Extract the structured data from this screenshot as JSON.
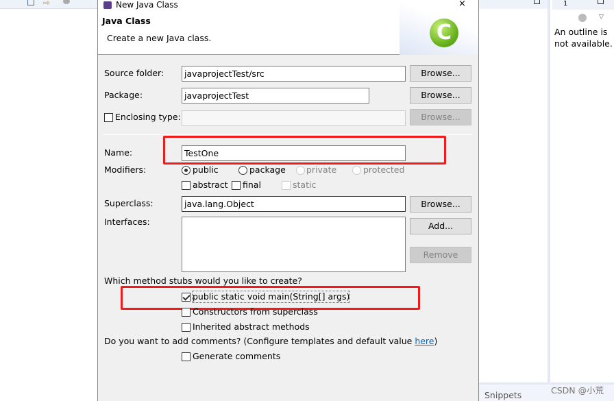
{
  "dialog": {
    "title": "New Java Class",
    "heading": "Java Class",
    "description": "Create a new Java class."
  },
  "form": {
    "source_folder": {
      "label": "Source folder:",
      "value": "javaprojectTest/src",
      "button": "Browse..."
    },
    "package": {
      "label": "Package:",
      "value": "javaprojectTest",
      "button": "Browse..."
    },
    "enclosing": {
      "label": "Enclosing type:",
      "value": "",
      "button": "Browse...",
      "checked": false
    },
    "name": {
      "label": "Name:",
      "value": "TestOne"
    },
    "modifiers": {
      "label": "Modifiers:",
      "radios": [
        {
          "label": "public",
          "selected": true
        },
        {
          "label": "package",
          "selected": false
        },
        {
          "label": "private",
          "disabled": true
        },
        {
          "label": "protected",
          "disabled": true
        }
      ],
      "checks": [
        {
          "label": "abstract",
          "checked": false
        },
        {
          "label": "final",
          "checked": false
        },
        {
          "label": "static",
          "disabled": true
        }
      ]
    },
    "superclass": {
      "label": "Superclass:",
      "value": "java.lang.Object",
      "button": "Browse..."
    },
    "interfaces": {
      "label": "Interfaces:",
      "add": "Add...",
      "remove": "Remove"
    },
    "stubs": {
      "question": "Which method stubs would you like to create?",
      "items": [
        {
          "label": "public static void main(String[] args)",
          "checked": true
        },
        {
          "label": "Constructors from superclass",
          "checked": false
        },
        {
          "label": "Inherited abstract methods",
          "checked": false
        }
      ]
    },
    "comments": {
      "question": "Do you want to add comments? (Configure templates and default value ",
      "link": "here",
      "close": ")",
      "generate": "Generate comments",
      "checked": false
    }
  },
  "outline": {
    "message": "An outline is not available.",
    "tab_number": "1"
  },
  "bottom": {
    "snippets": "Snippets",
    "watermark": "CSDN @小荒"
  },
  "colors": {
    "highlight": "#f01c1c",
    "link": "#0066cc"
  }
}
